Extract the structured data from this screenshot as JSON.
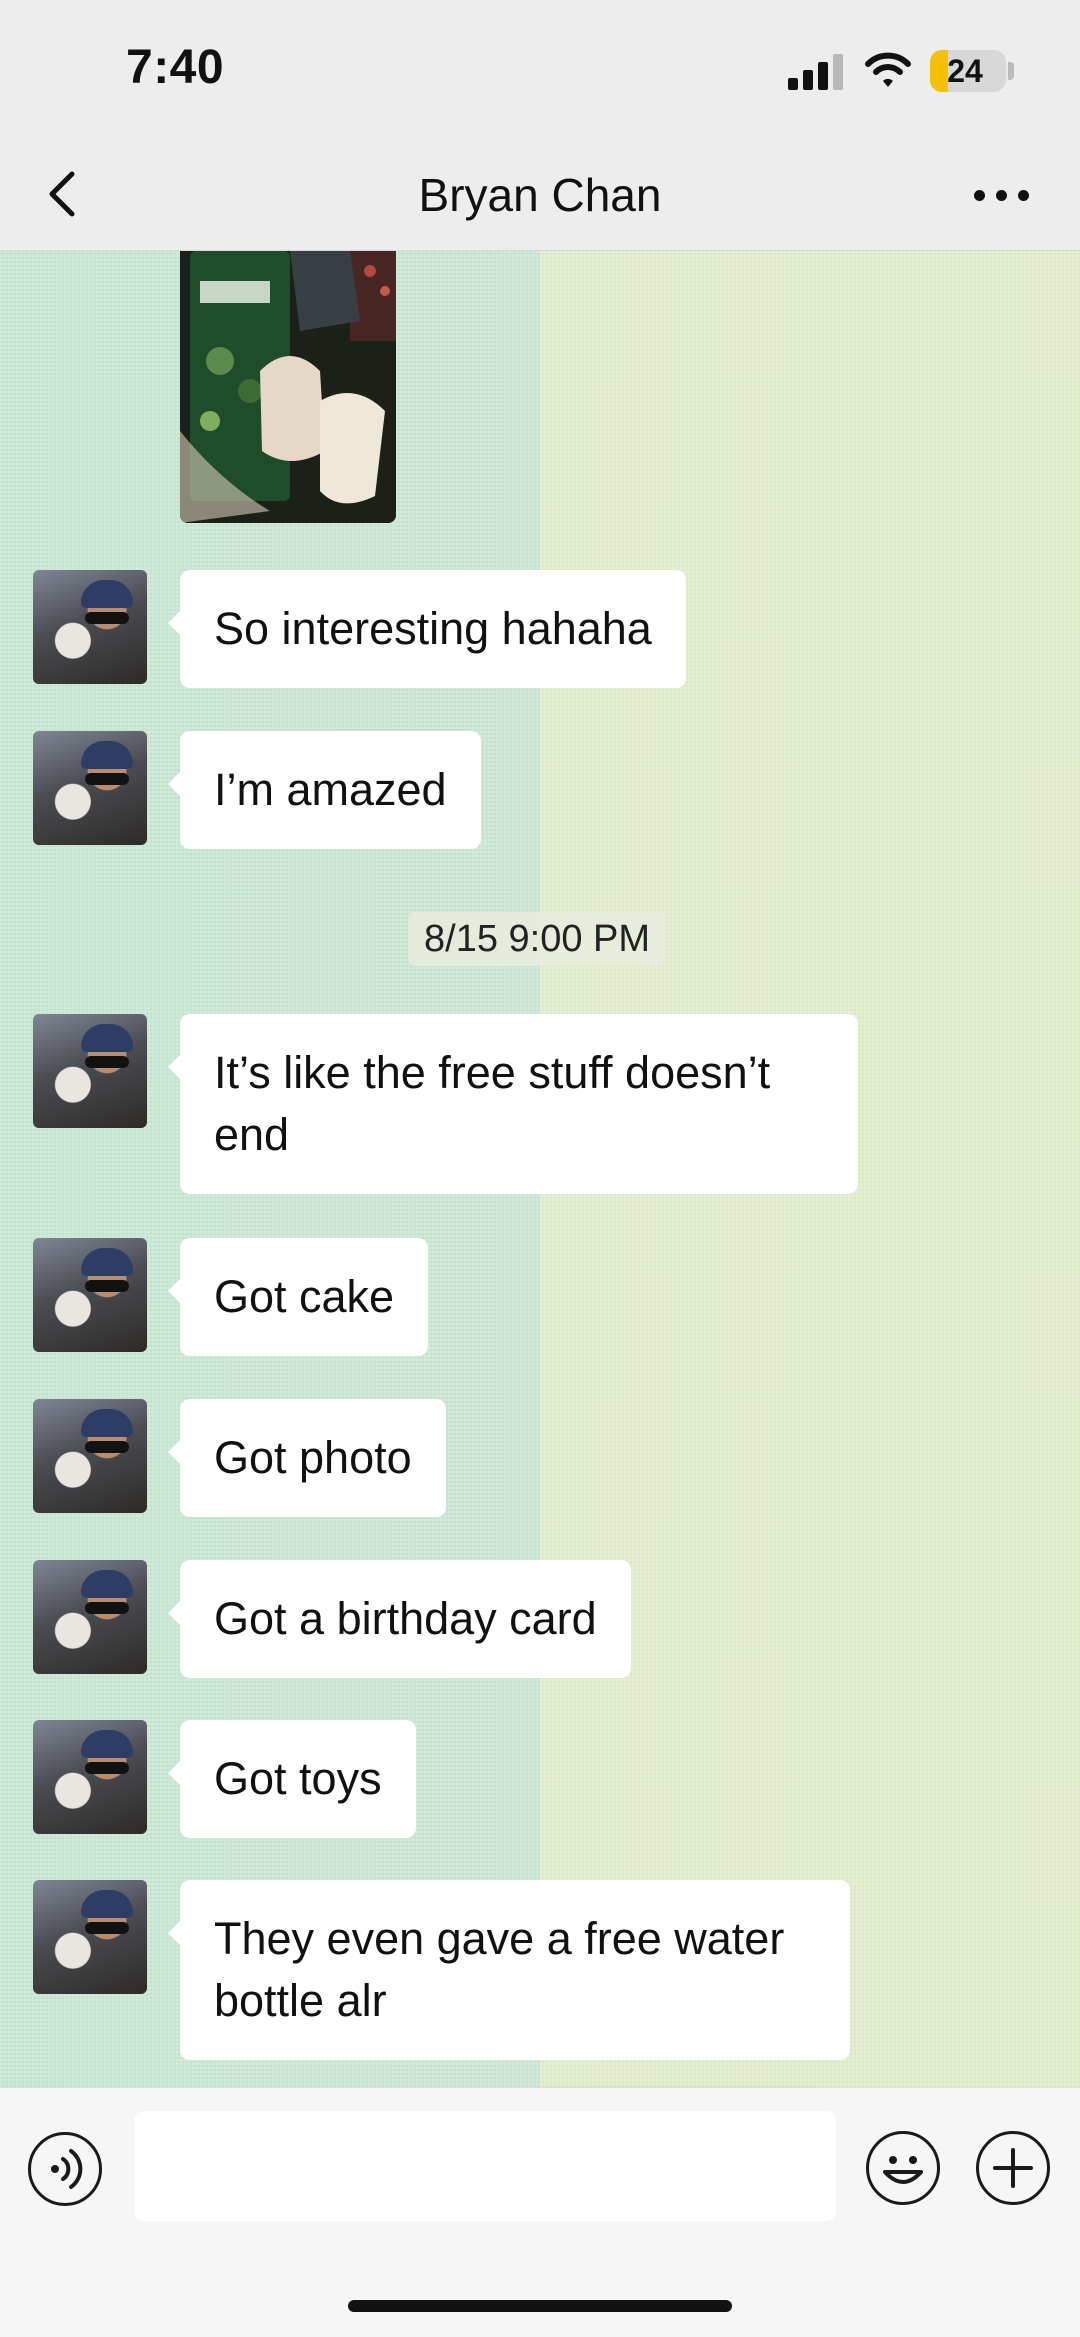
{
  "status_bar": {
    "time": "7:40",
    "battery_level": "24",
    "battery_color": "#f4c100"
  },
  "header": {
    "title": "Bryan Chan",
    "back_icon": "chevron-left-icon",
    "more_icon": "more-horizontal-icon"
  },
  "wallpaper": {
    "left_color": "#c9e9d5",
    "right_color": "#e4efcf"
  },
  "messages": [
    {
      "type": "image",
      "sender": "Bryan Chan"
    },
    {
      "type": "text",
      "sender": "Bryan Chan",
      "text": "So interesting hahaha"
    },
    {
      "type": "text",
      "sender": "Bryan Chan",
      "text": "I’m amazed"
    },
    {
      "type": "timestamp",
      "text": "8/15 9:00 PM"
    },
    {
      "type": "text",
      "sender": "Bryan Chan",
      "text": "It’s like the free stuff doesn’t end"
    },
    {
      "type": "text",
      "sender": "Bryan Chan",
      "text": "Got cake"
    },
    {
      "type": "text",
      "sender": "Bryan Chan",
      "text": "Got photo"
    },
    {
      "type": "text",
      "sender": "Bryan Chan",
      "text": "Got a birthday card"
    },
    {
      "type": "text",
      "sender": "Bryan Chan",
      "text": "Got toys"
    },
    {
      "type": "text",
      "sender": "Bryan Chan",
      "text": "They even gave a free water bottle alr"
    }
  ],
  "input_bar": {
    "value": "",
    "voice_icon": "voice-icon",
    "emoji_icon": "emoji-icon",
    "plus_icon": "plus-icon"
  }
}
